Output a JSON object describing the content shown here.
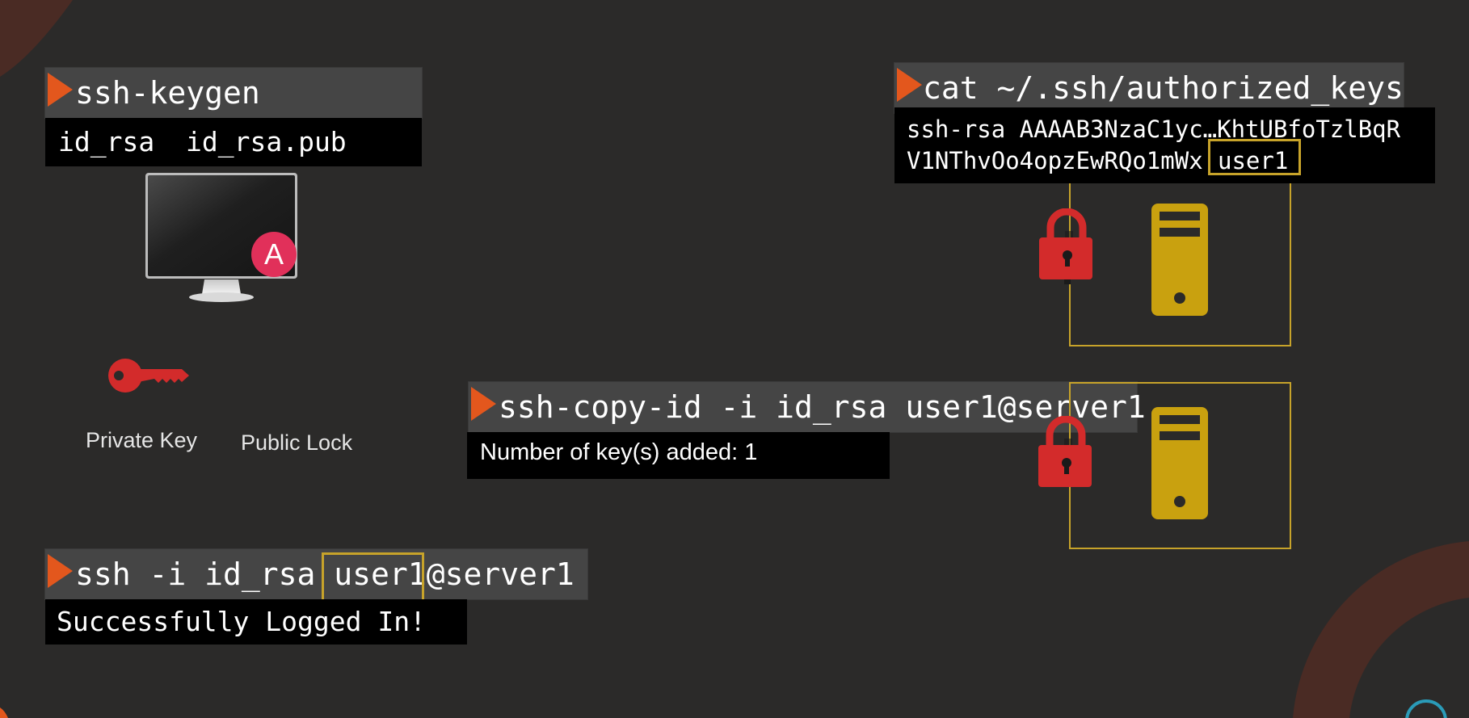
{
  "keygen": {
    "command": "ssh-keygen",
    "output_left": "id_rsa",
    "output_right": "id_rsa.pub"
  },
  "client": {
    "private_key_label": "Private Key",
    "public_lock_label": "Public Lock",
    "logo_letter": "A"
  },
  "authorized_keys": {
    "command": "cat ~/.ssh/authorized_keys",
    "line1": "ssh-rsa AAAAB3NzaC1yc…KhtUBfoTzlBqR",
    "line2": "V1NThvOo4opzEwRQo1mWx",
    "user": "user1"
  },
  "copy_id": {
    "command": "ssh-copy-id -i id_rsa user1@server1",
    "output": "Number of key(s) added: 1"
  },
  "login": {
    "command_prefix": "ssh -i id_rsa ",
    "command_user": "user1",
    "command_suffix": "@server1",
    "output": "Successfully Logged In!"
  },
  "colors": {
    "background": "#2b2a29",
    "accent_orange": "#e3571d",
    "highlight_gold": "#c7a32a",
    "lock_red": "#d32b2b",
    "server_gold": "#c9a10f",
    "ansible_red": "#e1305a"
  },
  "icons": [
    "play-icon",
    "monitor-icon",
    "ansible-logo-icon",
    "key-icon",
    "padlock-icon",
    "server-icon"
  ]
}
